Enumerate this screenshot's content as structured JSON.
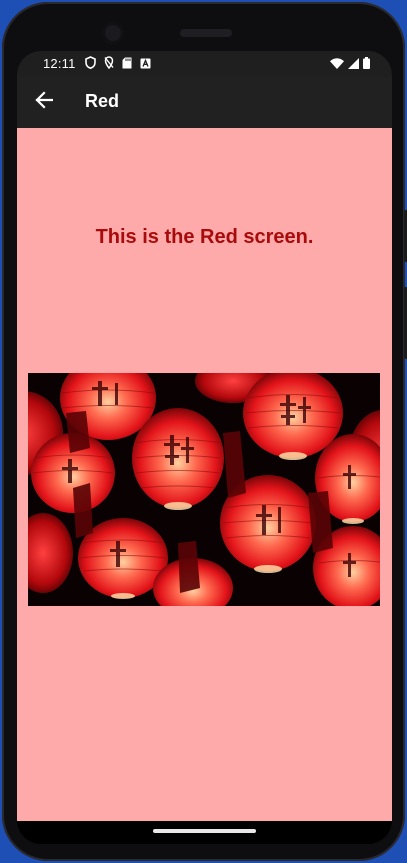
{
  "status_bar": {
    "time": "12:11",
    "left_icons": [
      "shield-icon",
      "location-off-icon",
      "sd-card-icon",
      "font-a-icon"
    ],
    "right_icons": [
      "wifi-icon",
      "signal-icon",
      "battery-icon"
    ]
  },
  "app_bar": {
    "back_icon": "arrow-back-icon",
    "title": "Red"
  },
  "content": {
    "headline": "This is the Red screen.",
    "image_subject": "red-paper-lanterns",
    "background_color": "#ffaaaa",
    "headline_color": "#a80b0b"
  },
  "nav_bar": {
    "home_indicator": "home-pill"
  }
}
